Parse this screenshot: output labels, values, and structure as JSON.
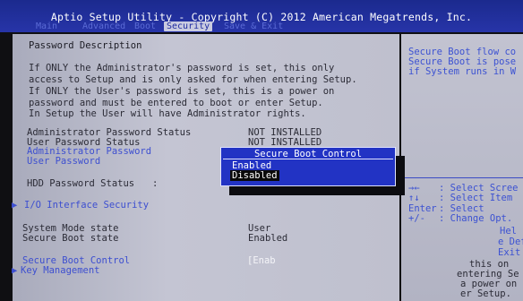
{
  "header": {
    "title": "Aptio Setup Utility - Copyright (C) 2012 American Megatrends, Inc.",
    "tabs": [
      "Main",
      "Advanced",
      "Boot",
      "Security",
      "Save & Exit"
    ],
    "active_tab": "Security"
  },
  "main": {
    "section_title": "Password Description",
    "description": [
      "If ONLY the Administrator's password is set, this only",
      "access to Setup and is only asked for when entering Setup.",
      "If ONLY the User's password is set, this is a power on",
      "password and must be entered to boot or enter Setup.",
      "In Setup the User will have Administrator rights."
    ],
    "rows": {
      "admin_status_label": "Administrator Password Status",
      "admin_status_value": "NOT INSTALLED",
      "user_status_label": "User Password Status",
      "user_status_value": "NOT INSTALLED",
      "admin_password_label": "Administrator Password",
      "user_password_label": "User Password",
      "hdd_status_label": "HDD Password Status",
      "hdd_status_sep": ":",
      "io_security_label": "I/O Interface Security",
      "system_mode_label": "System Mode state",
      "system_mode_value": "User",
      "secure_boot_state_label": "Secure Boot state",
      "secure_boot_state_value": "Enabled",
      "secure_boot_control_label": "Secure Boot Control",
      "secure_boot_control_value": "[Enab",
      "key_management_label": "Key Management"
    },
    "submenu_marker": "▶"
  },
  "popup": {
    "title": "Secure Boot Control",
    "options": [
      "Enabled",
      "Disabled"
    ],
    "selected": "Disabled"
  },
  "help": {
    "lines": [
      "Secure Boot flow co",
      "Secure Boot is pose",
      "if System runs in W"
    ],
    "keys": [
      {
        "key": "→←",
        "desc": ": Select Scree"
      },
      {
        "key": "↑↓",
        "desc": ": Select Item"
      },
      {
        "key": "Enter",
        "desc": ": Select"
      },
      {
        "key": "+/-",
        "desc": ": Change Opt."
      }
    ],
    "extra": [
      "Hel",
      "e Def",
      "Exit",
      "this on",
      "entering Se",
      "a power on",
      "er Setup."
    ]
  }
}
